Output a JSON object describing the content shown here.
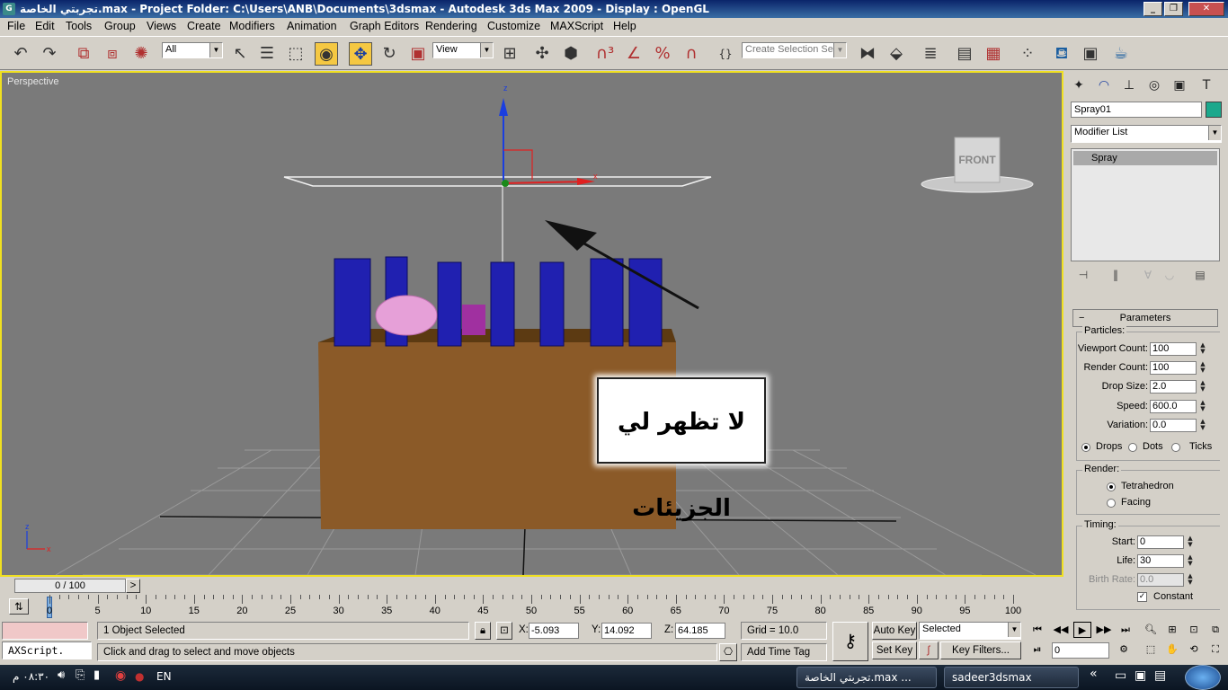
{
  "window": {
    "title": "تجربتي الخاصة.max    - Project Folder: C:\\Users\\ANB\\Documents\\3dsmax    - Autodesk 3ds Max  2009     - Display : OpenGL",
    "app_icon": "G",
    "minimize": "_",
    "restore": "❐",
    "close": "✕"
  },
  "menu": [
    "File",
    "Edit",
    "Tools",
    "Group",
    "Views",
    "Create",
    "Modifiers",
    "Animation",
    "Graph Editors",
    "Rendering",
    "Customize",
    "MAXScript",
    "Help"
  ],
  "toolbar": {
    "selection_filter": "All",
    "reference_coord": "View",
    "named_selection_placeholder": "Create Selection Set",
    "icons": [
      "undo-icon",
      "redo-icon",
      "select-link-icon",
      "unlink-icon",
      "bind-spacewarp-icon",
      "select-object-icon",
      "select-by-name-icon",
      "rect-region-icon",
      "window-crossing-icon",
      "select-move-icon",
      "select-rotate-icon",
      "select-scale-icon",
      "pivot-icon",
      "manipulate-icon",
      "keyboard-shortcut-icon",
      "snap-icon",
      "angle-snap-icon",
      "percent-snap-icon",
      "spinner-snap-icon",
      "edit-named-sel-icon",
      "mirror-icon",
      "align-icon",
      "layer-manager-icon",
      "curve-editor-icon",
      "schematic-view-icon",
      "material-editor-icon",
      "render-setup-icon",
      "rendered-frame-icon",
      "quick-render-icon"
    ]
  },
  "viewport": {
    "label": "Perspective",
    "viewcube_face": "FRONT",
    "gizmo_z": "z",
    "gizmo_x": "x",
    "axis_z": "z",
    "axis_x": "x",
    "annotation": "لا تظهر لي الجزيئات"
  },
  "command_panel": {
    "tabs": [
      "create-tab-icon",
      "modify-tab-icon",
      "hierarchy-tab-icon",
      "motion-tab-icon",
      "display-tab-icon",
      "utilities-tab-icon"
    ],
    "object_name": "Spray01",
    "object_color": "#1ba88c",
    "modifier_list": "Modifier List",
    "stack_item": "Spray",
    "rollout_title": "Parameters",
    "rollout_toggle": "−",
    "particles_label": "Particles:",
    "viewport_count_label": "Viewport Count:",
    "viewport_count": "100",
    "render_count_label": "Render Count:",
    "render_count": "100",
    "drop_size_label": "Drop Size:",
    "drop_size": "2.0",
    "speed_label": "Speed:",
    "speed": "600.0",
    "variation_label": "Variation:",
    "variation": "0.0",
    "drops": "Drops",
    "dots": "Dots",
    "ticks": "Ticks",
    "render_label": "Render:",
    "tetrahedron": "Tetrahedron",
    "facing": "Facing",
    "timing_label": "Timing:",
    "start_label": "Start:",
    "start": "0",
    "life_label": "Life:",
    "life": "30",
    "birth_rate_label": "Birth Rate:",
    "birth_rate": "0.0",
    "constant": "Constant"
  },
  "timeline": {
    "frame": "0 / 100",
    "prev": "<",
    "next": ">",
    "ticks": [
      "0",
      "5",
      "10",
      "15",
      "20",
      "25",
      "30",
      "35",
      "40",
      "45",
      "50",
      "55",
      "60",
      "65",
      "70",
      "75",
      "80",
      "85",
      "90",
      "95",
      "100"
    ]
  },
  "status": {
    "maxscript": "AXScript.",
    "selected": "1 Object Selected",
    "prompt": "Click and drag to select and move objects",
    "x_label": "X:",
    "x": "-5.093",
    "y_label": "Y:",
    "y": "14.092",
    "z_label": "Z:",
    "z": "64.185",
    "grid": "Grid = 10.0",
    "add_time_tag": "Add Time Tag",
    "auto_key": "Auto Key",
    "set_key": "Set Key",
    "selected_combo": "Selected",
    "key_filters": "Key Filters...",
    "current_frame": "0"
  },
  "taskbar": {
    "clock": "٠٨:٣٠ م",
    "lang": "EN",
    "task1": "تجربتي الخاصة.max ...",
    "task2": "sadeer3dsmax",
    "arrow": "«"
  }
}
